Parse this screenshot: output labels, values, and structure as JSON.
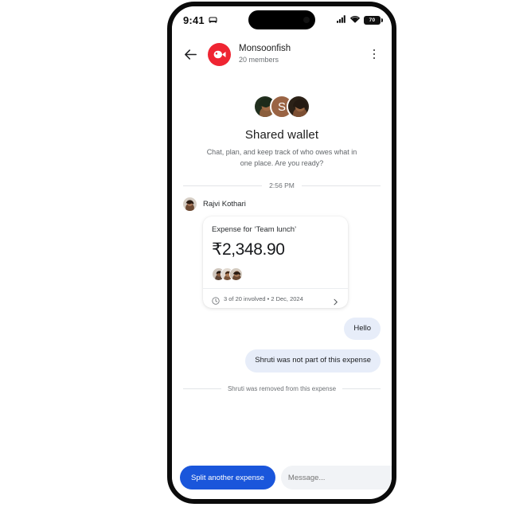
{
  "status_bar": {
    "time": "9:41",
    "alarm_icon": "alarm-icon",
    "signal_icon": "cellular-signal-icon",
    "wifi_icon": "wifi-icon",
    "battery_level": "70"
  },
  "header": {
    "back_icon": "back-arrow-icon",
    "avatar_icon": "fish-avatar-icon",
    "title": "Monsoonfish",
    "subtitle": "20 members",
    "menu_icon": "more-vertical-icon"
  },
  "intro": {
    "avatars": [
      {
        "type": "photo",
        "name": "member-avatar-1"
      },
      {
        "type": "initial",
        "initial": "S",
        "color": "#9a6444",
        "name": "member-avatar-2"
      },
      {
        "type": "photo",
        "name": "member-avatar-3"
      }
    ],
    "title": "Shared wallet",
    "subtitle": "Chat, plan, and keep track of who owes what in one place. Are you ready?"
  },
  "timestamp_divider": {
    "label": "2:56 PM"
  },
  "message_sender": {
    "avatar_name": "rajvi-avatar",
    "name": "Rajvi Kothari"
  },
  "expense_card": {
    "title": "Expense for ‘Team lunch’",
    "amount": "₹2,348.90",
    "participant_avatars": [
      "participant-1",
      "participant-2",
      "participant-3"
    ],
    "clock_icon": "clock-icon",
    "meta": "3 of 20 involved • 2 Dec, 2024",
    "chevron_icon": "chevron-right-icon"
  },
  "messages": [
    {
      "text": "Hello",
      "align": "right"
    },
    {
      "text": "Shruti was not part of this expense",
      "align": "right"
    }
  ],
  "system_divider": {
    "label": "Shruti was removed from this expense"
  },
  "composer": {
    "split_button_label": "Split another expense",
    "message_placeholder": "Message...",
    "message_value": "",
    "send_icon": "send-icon"
  },
  "colors": {
    "accent_blue": "#1a56db",
    "bubble_blue": "#e7edf9",
    "avatar_red": "#ef2532",
    "initial_brown": "#9a6444"
  }
}
